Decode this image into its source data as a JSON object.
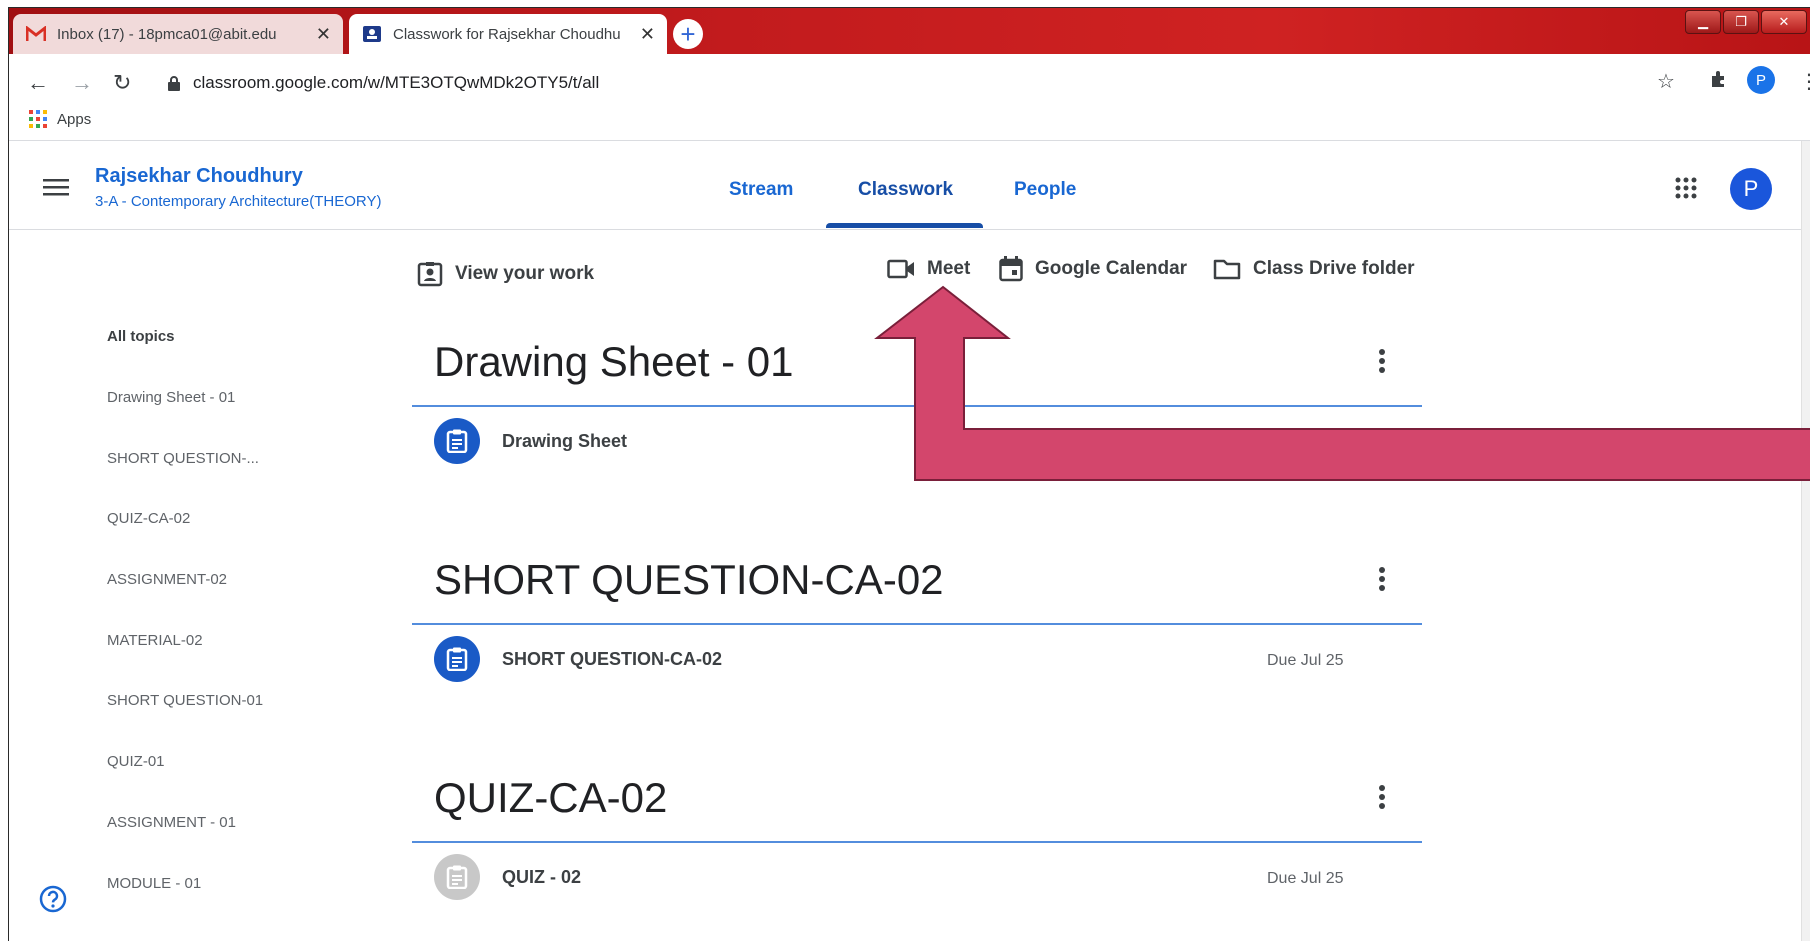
{
  "browser": {
    "tabs": [
      {
        "title": "Inbox (17) - 18pmca01@abit.edu",
        "icon": "gmail-icon",
        "active": false
      },
      {
        "title": "Classwork for Rajsekhar Choudhu",
        "icon": "classroom-icon",
        "active": true
      }
    ],
    "new_tab": "+",
    "url": "classroom.google.com/w/MTE3OTQwMDk2OTY5/t/all",
    "profile_initial": "P",
    "bookmarks": {
      "apps_label": "Apps"
    }
  },
  "classroom": {
    "teacher_name": "Rajsekhar Choudhury",
    "class_name": "3-A - Contemporary Architecture(THEORY)",
    "nav": [
      {
        "label": "Stream",
        "active": false
      },
      {
        "label": "Classwork",
        "active": true
      },
      {
        "label": "People",
        "active": false
      }
    ],
    "profile_initial": "P",
    "accent_color": "#1967d2"
  },
  "actions": {
    "view_work": "View your work",
    "meet": "Meet",
    "calendar": "Google Calendar",
    "drive": "Class Drive folder"
  },
  "topics": [
    {
      "label": "All topics",
      "selected": true
    },
    {
      "label": "Drawing Sheet - 01",
      "selected": false
    },
    {
      "label": "SHORT QUESTION-...",
      "selected": false
    },
    {
      "label": "QUIZ-CA-02",
      "selected": false
    },
    {
      "label": "ASSIGNMENT-02",
      "selected": false
    },
    {
      "label": "MATERIAL-02",
      "selected": false
    },
    {
      "label": "SHORT QUESTION-01",
      "selected": false
    },
    {
      "label": "QUIZ-01",
      "selected": false
    },
    {
      "label": "ASSIGNMENT - 01",
      "selected": false
    },
    {
      "label": "MODULE - 01",
      "selected": false
    }
  ],
  "sections": [
    {
      "title": "Drawing Sheet - 01",
      "items": [
        {
          "name": "Drawing Sheet",
          "due": "",
          "icon_state": "active"
        }
      ]
    },
    {
      "title": "SHORT QUESTION-CA-02",
      "items": [
        {
          "name": "SHORT QUESTION-CA-02",
          "due": "Due Jul 25",
          "icon_state": "active"
        }
      ]
    },
    {
      "title": "QUIZ-CA-02",
      "items": [
        {
          "name": "QUIZ - 02",
          "due": "Due Jul 25",
          "icon_state": "disabled"
        }
      ]
    }
  ],
  "annotation": {
    "arrow_color": "#d3466c"
  }
}
